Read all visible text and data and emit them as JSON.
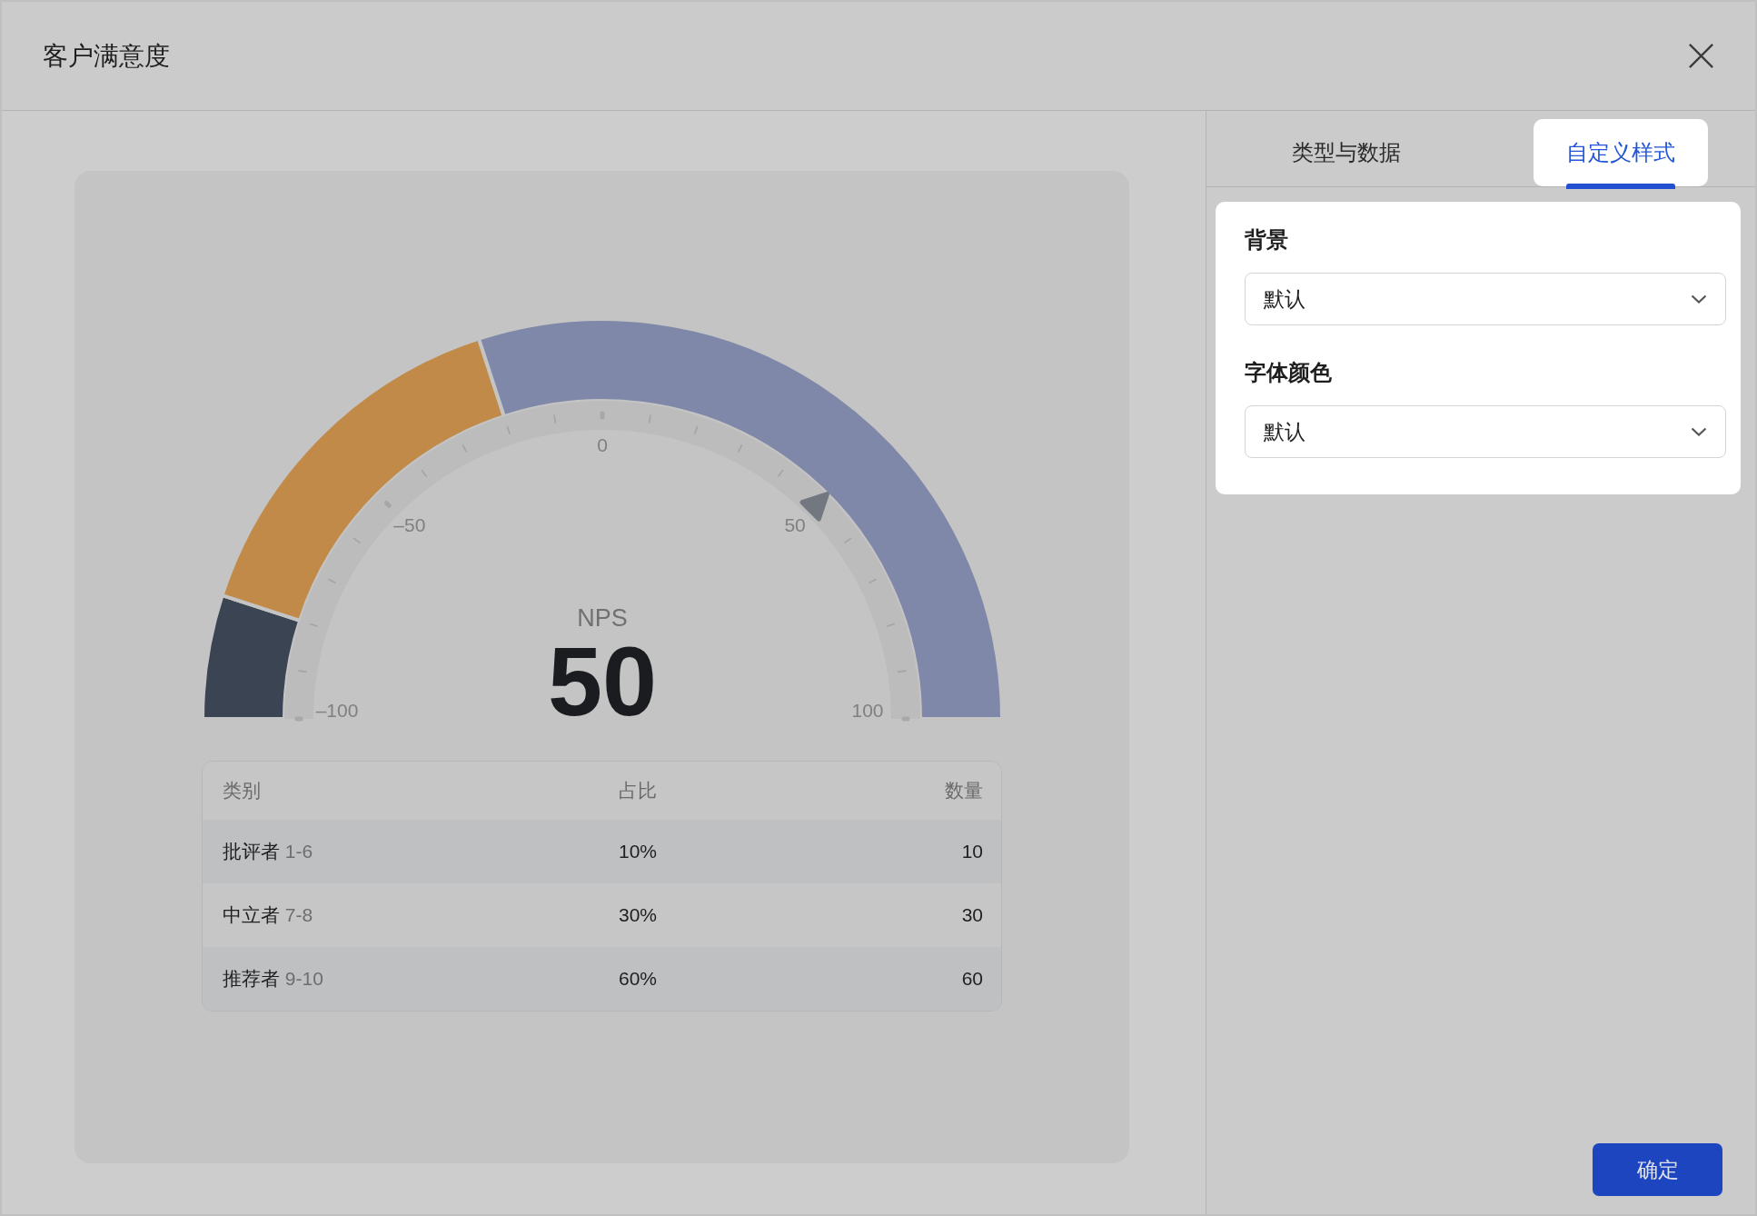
{
  "dialog": {
    "title": "客户满意度"
  },
  "gauge": {
    "label": "NPS",
    "value": "50",
    "pointer": {
      "level": 0.75
    },
    "ticks": [
      "–100",
      "–50",
      "0",
      "50",
      "100"
    ],
    "segments": [
      {
        "color": "#3a4452"
      },
      {
        "color": "#c28a48"
      },
      {
        "color": "#7f88a8"
      }
    ],
    "chart_data": {
      "type": "donut",
      "series": [
        {
          "values": [
            10,
            30,
            60
          ]
        }
      ]
    }
  },
  "table": {
    "columns": [
      "类别",
      "占比",
      "数量"
    ],
    "rows": [
      {
        "name": "批评者",
        "range": "1-6",
        "share": "10%",
        "count": "10"
      },
      {
        "name": "中立者",
        "range": "7-8",
        "share": "30%",
        "count": "30"
      },
      {
        "name": "推荐者",
        "range": "9-10",
        "share": "60%",
        "count": "60"
      }
    ]
  },
  "tabs": [
    {
      "label": "类型与数据",
      "selected": false
    },
    {
      "label": "自定义样式",
      "selected": true
    }
  ],
  "fields": [
    {
      "label": "背景",
      "value": "默认"
    },
    {
      "label": "字体颜色",
      "value": "默认"
    }
  ],
  "confirm_button": "确定"
}
